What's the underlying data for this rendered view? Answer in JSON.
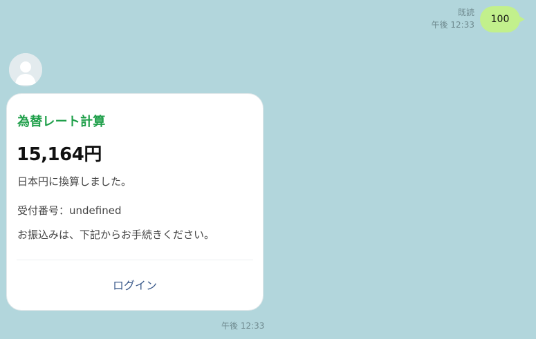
{
  "sent_message": {
    "read_label": "既読",
    "time": "午後 12:33",
    "text": "100",
    "bubble_color": "#c2f08c"
  },
  "received_message": {
    "avatar_icon": "default-user-avatar-icon",
    "card": {
      "title": "為替レート計算",
      "title_color": "#1f9f4a",
      "amount": "15,164円",
      "converted_text": "日本円に換算しました。",
      "receipt_label": "受付番号：undefined",
      "instruction": "お振込みは、下記からお手続きください。",
      "login_button_label": "ログイン",
      "login_button_color": "#3d5c8c"
    },
    "time": "午後 12:33"
  },
  "background_color": "#b2d6dc"
}
